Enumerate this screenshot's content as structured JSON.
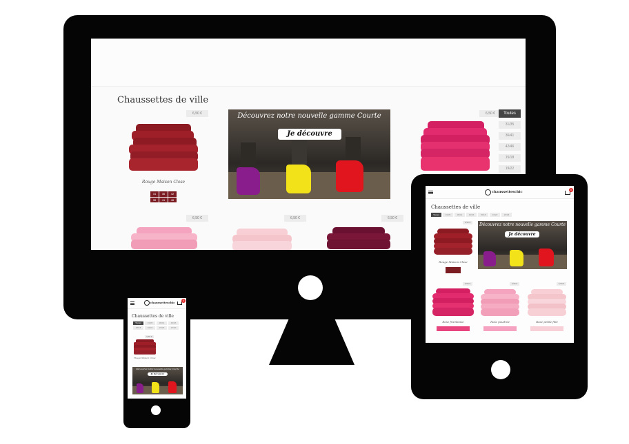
{
  "desktop": {
    "page_title": "Chaussettes de ville",
    "banner": {
      "headline": "Découvrez notre nouvelle gamme Courte",
      "cta": "Je découvre"
    },
    "products_row1": [
      {
        "name": "Rouge Maison Close",
        "price": "6,50 €",
        "sizes": [
          "31",
          "35",
          "36",
          "41",
          "42",
          "46"
        ]
      },
      {
        "name": "",
        "price": "6,50 €",
        "sizes": []
      }
    ],
    "products_row2": [
      {
        "price": "6,50 €"
      },
      {
        "price": "6,50 €"
      },
      {
        "price": "6,50 €"
      }
    ],
    "size_filters": [
      "Toutes",
      "31/35",
      "36/41",
      "42/46",
      "15/18",
      "19/22"
    ]
  },
  "tablet": {
    "logo": "chaussetteschic",
    "cart_count": "0",
    "page_title": "Chaussettes de ville",
    "size_filters": [
      "Toutes",
      "31/35",
      "36/41",
      "42/46",
      "15/18",
      "19/22",
      "23/26"
    ],
    "banner": {
      "headline": "Découvrez notre nouvelle gamme Courte",
      "cta": "Je découvre"
    },
    "products": [
      {
        "name": "Rouge Maison Close",
        "price": "6,50 €"
      },
      {
        "name": "Rose framboise",
        "price": "6,50 €"
      },
      {
        "name": "Rose poudrée",
        "price": "6,50 €"
      },
      {
        "name": "Rose petite fille",
        "price": "6,50 €"
      }
    ]
  },
  "phone": {
    "logo": "chaussetteschic",
    "cart_count": "0",
    "page_title": "Chaussettes de ville",
    "size_filters": [
      "Toutes",
      "31/35",
      "36/41",
      "42/46",
      "15/18",
      "19/22",
      "23/26",
      "27/30"
    ],
    "products": [
      {
        "name": "Rouge Maison Close",
        "price": "6,50 €"
      }
    ],
    "banner": {
      "headline": "Découvrez notre nouvelle gamme Courte",
      "cta": "Je découvre"
    }
  },
  "colors": {
    "device": "#050505",
    "sock_red": "#9b1c24",
    "sock_fuchsia": "#e0246b",
    "sock_pink": "#f3a6bd",
    "sock_light_pink": "#f7d2d6",
    "sock_burgundy": "#6e1432",
    "size_chip_red": "#7a1c22",
    "size_chip_pink": "#e8457f"
  }
}
